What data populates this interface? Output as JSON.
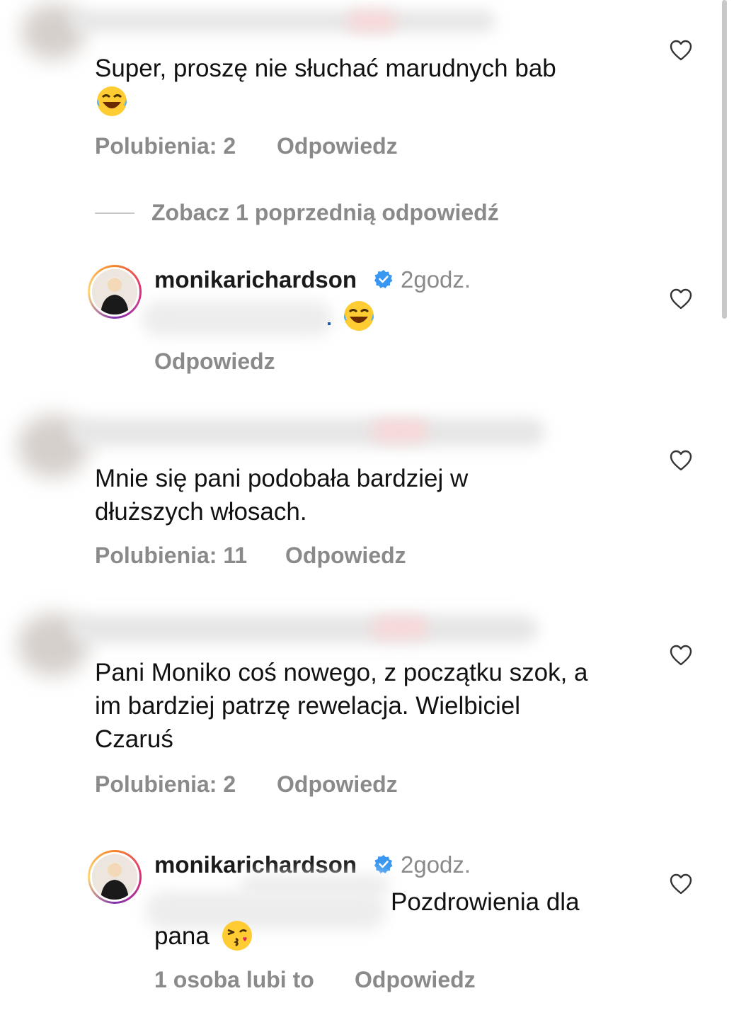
{
  "comments": [
    {
      "text": "Super, proszę nie słuchać marudnych bab",
      "likes": "Polubienia: 2",
      "reply": "Odpowiedz"
    },
    {
      "text": "Mnie się pani podobała bardziej w dłuższych włosach.",
      "likes": "Polubienia: 11",
      "reply": "Odpowiedz"
    },
    {
      "text": "Pani Moniko coś nowego, z początku szok, a im bardziej patrzę rewelacja. Wielbiciel Czaruś",
      "likes": "Polubienia: 2",
      "reply": "Odpowiedz"
    }
  ],
  "view_previous": "Zobacz 1 poprzednią odpowiedź",
  "replies": [
    {
      "username": "monikarichardson",
      "time": "2godz.",
      "text": "",
      "reply": "Odpowiedz",
      "emoji": "laughing-crying-emoji"
    },
    {
      "username": "monikarichardson",
      "time": "2godz.",
      "text_line1": "Pozdrowienia dla",
      "text_line2": "pana",
      "likes": "1 osoba lubi to",
      "reply": "Odpowiedz",
      "emoji": "kissing-heart-emoji"
    }
  ],
  "colors": {
    "text": "#111111",
    "meta": "#8a8a8a",
    "verified": "#3897f0"
  }
}
